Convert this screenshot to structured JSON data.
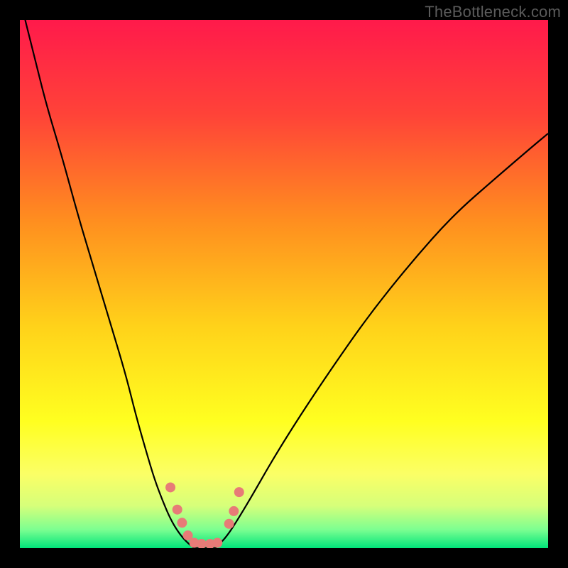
{
  "watermark": "TheBottleneck.com",
  "chart_data": {
    "type": "line",
    "title": "",
    "xlabel": "",
    "ylabel": "",
    "xlim": [
      0,
      100
    ],
    "ylim": [
      0,
      100
    ],
    "background_gradient": [
      {
        "offset": 0.0,
        "color": "#ff1a4b"
      },
      {
        "offset": 0.18,
        "color": "#ff4338"
      },
      {
        "offset": 0.38,
        "color": "#ff8e1f"
      },
      {
        "offset": 0.58,
        "color": "#ffd21a"
      },
      {
        "offset": 0.76,
        "color": "#ffff20"
      },
      {
        "offset": 0.86,
        "color": "#fbff66"
      },
      {
        "offset": 0.92,
        "color": "#d6ff7a"
      },
      {
        "offset": 0.965,
        "color": "#7cff91"
      },
      {
        "offset": 1.0,
        "color": "#00e57a"
      }
    ],
    "series": [
      {
        "name": "left-curve",
        "x": [
          1,
          3,
          5,
          8,
          11,
          14,
          17,
          20,
          22,
          24,
          25.5,
          27,
          28.5,
          30,
          31.5,
          33
        ],
        "y": [
          100,
          92,
          84,
          74,
          63,
          53,
          43,
          33,
          25,
          18,
          13,
          9,
          5.5,
          3,
          1.2,
          0
        ]
      },
      {
        "name": "right-curve",
        "x": [
          37,
          39,
          41,
          44,
          48,
          53,
          59,
          66,
          74,
          82,
          90,
          97,
          100
        ],
        "y": [
          0,
          2,
          5,
          10,
          17,
          25,
          34,
          44,
          54,
          63,
          70,
          76,
          78.5
        ]
      }
    ],
    "valley_floor": {
      "x_start": 33,
      "x_end": 37,
      "y": 0
    },
    "markers": {
      "color": "#e77b77",
      "radius_px": 7,
      "points": [
        {
          "x": 28.5,
          "y": 11.5
        },
        {
          "x": 29.8,
          "y": 7.3
        },
        {
          "x": 30.7,
          "y": 4.8
        },
        {
          "x": 31.8,
          "y": 2.4
        },
        {
          "x": 33.0,
          "y": 1.0
        },
        {
          "x": 34.4,
          "y": 0.8
        },
        {
          "x": 36.0,
          "y": 0.8
        },
        {
          "x": 37.4,
          "y": 1.0
        },
        {
          "x": 39.6,
          "y": 4.6
        },
        {
          "x": 40.5,
          "y": 7.0
        },
        {
          "x": 41.5,
          "y": 10.6
        }
      ]
    }
  }
}
